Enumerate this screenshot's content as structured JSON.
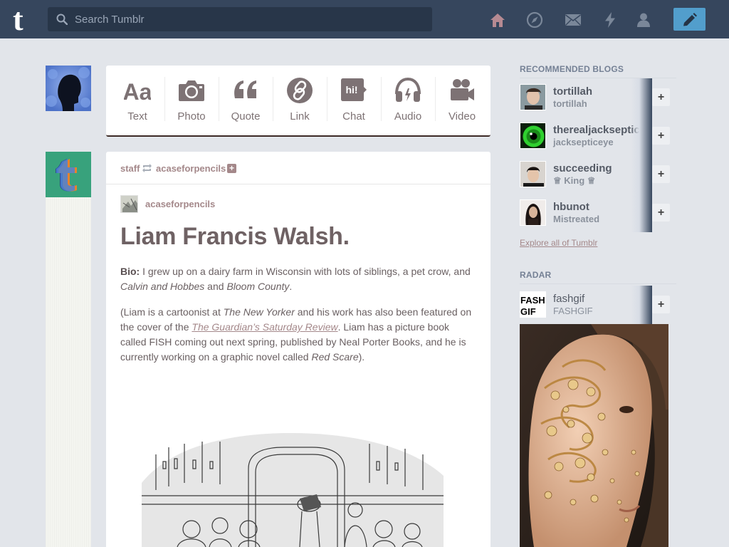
{
  "header": {
    "logo_letter": "t",
    "search_placeholder": "Search Tumblr",
    "nav_icons": [
      "home-icon",
      "explore-icon",
      "inbox-icon",
      "activity-icon",
      "account-icon"
    ],
    "compose_icon": "pencil-icon",
    "colors": {
      "bar": "#36465d",
      "search": "#283649",
      "compose": "#529ecc",
      "active_nav": "#b68a92"
    }
  },
  "composer": {
    "types": [
      {
        "label": "Text",
        "icon": "text-icon",
        "glyph": "Aa"
      },
      {
        "label": "Photo",
        "icon": "camera-icon"
      },
      {
        "label": "Quote",
        "icon": "quote-icon",
        "glyph": "“"
      },
      {
        "label": "Link",
        "icon": "link-icon"
      },
      {
        "label": "Chat",
        "icon": "chat-icon",
        "glyph": "hi!"
      },
      {
        "label": "Audio",
        "icon": "headphones-icon"
      },
      {
        "label": "Video",
        "icon": "video-camera-icon"
      }
    ]
  },
  "post": {
    "reblogged_by": "staff",
    "reblogged_from": "acaseforpencils",
    "source_blog": "acaseforpencils",
    "title": "Liam Francis Walsh.",
    "bio_label": "Bio:",
    "bio_text_1": " I grew up on a dairy farm in Wisconsin with lots of siblings, a pet crow, and ",
    "bio_em_1": "Calvin and Hobbes",
    "bio_text_2": " and ",
    "bio_em_2": "Bloom County",
    "bio_text_3": ".",
    "para2_1": "(Liam is a cartoonist at ",
    "para2_em_1": "The New Yorker",
    "para2_2": " and his work has also been featured on the cover of the ",
    "para2_link": "The Guardian’s Saturday Review",
    "para2_3": ". Liam has a picture book called FISH coming out next spring, published by Neal Porter Books, and he is currently working on a graphic novel called ",
    "para2_em_2": "Red Scare",
    "para2_4": ")."
  },
  "sidebar": {
    "recommended_heading": "RECOMMENDED BLOGS",
    "recommended": [
      {
        "name": "tortillah",
        "subtitle": "tortillah",
        "avatar_color": "#7b8a92"
      },
      {
        "name": "therealjacksepticeye",
        "subtitle": "jacksepticeye",
        "avatar_color": "#1e8a1e"
      },
      {
        "name": "succeeding",
        "subtitle": "♕ King ♕",
        "avatar_color": "#3c3a38"
      },
      {
        "name": "hbunot",
        "subtitle": "Mistreated",
        "avatar_color": "#5a4a44"
      }
    ],
    "explore_link": "Explore all of Tumblr",
    "radar_heading": "RADAR",
    "radar": {
      "name": "fashgif",
      "subtitle": "FASHGIF",
      "avatar_text_1": "FASH",
      "avatar_text_2": "GIF"
    },
    "follow_glyph": "+"
  }
}
